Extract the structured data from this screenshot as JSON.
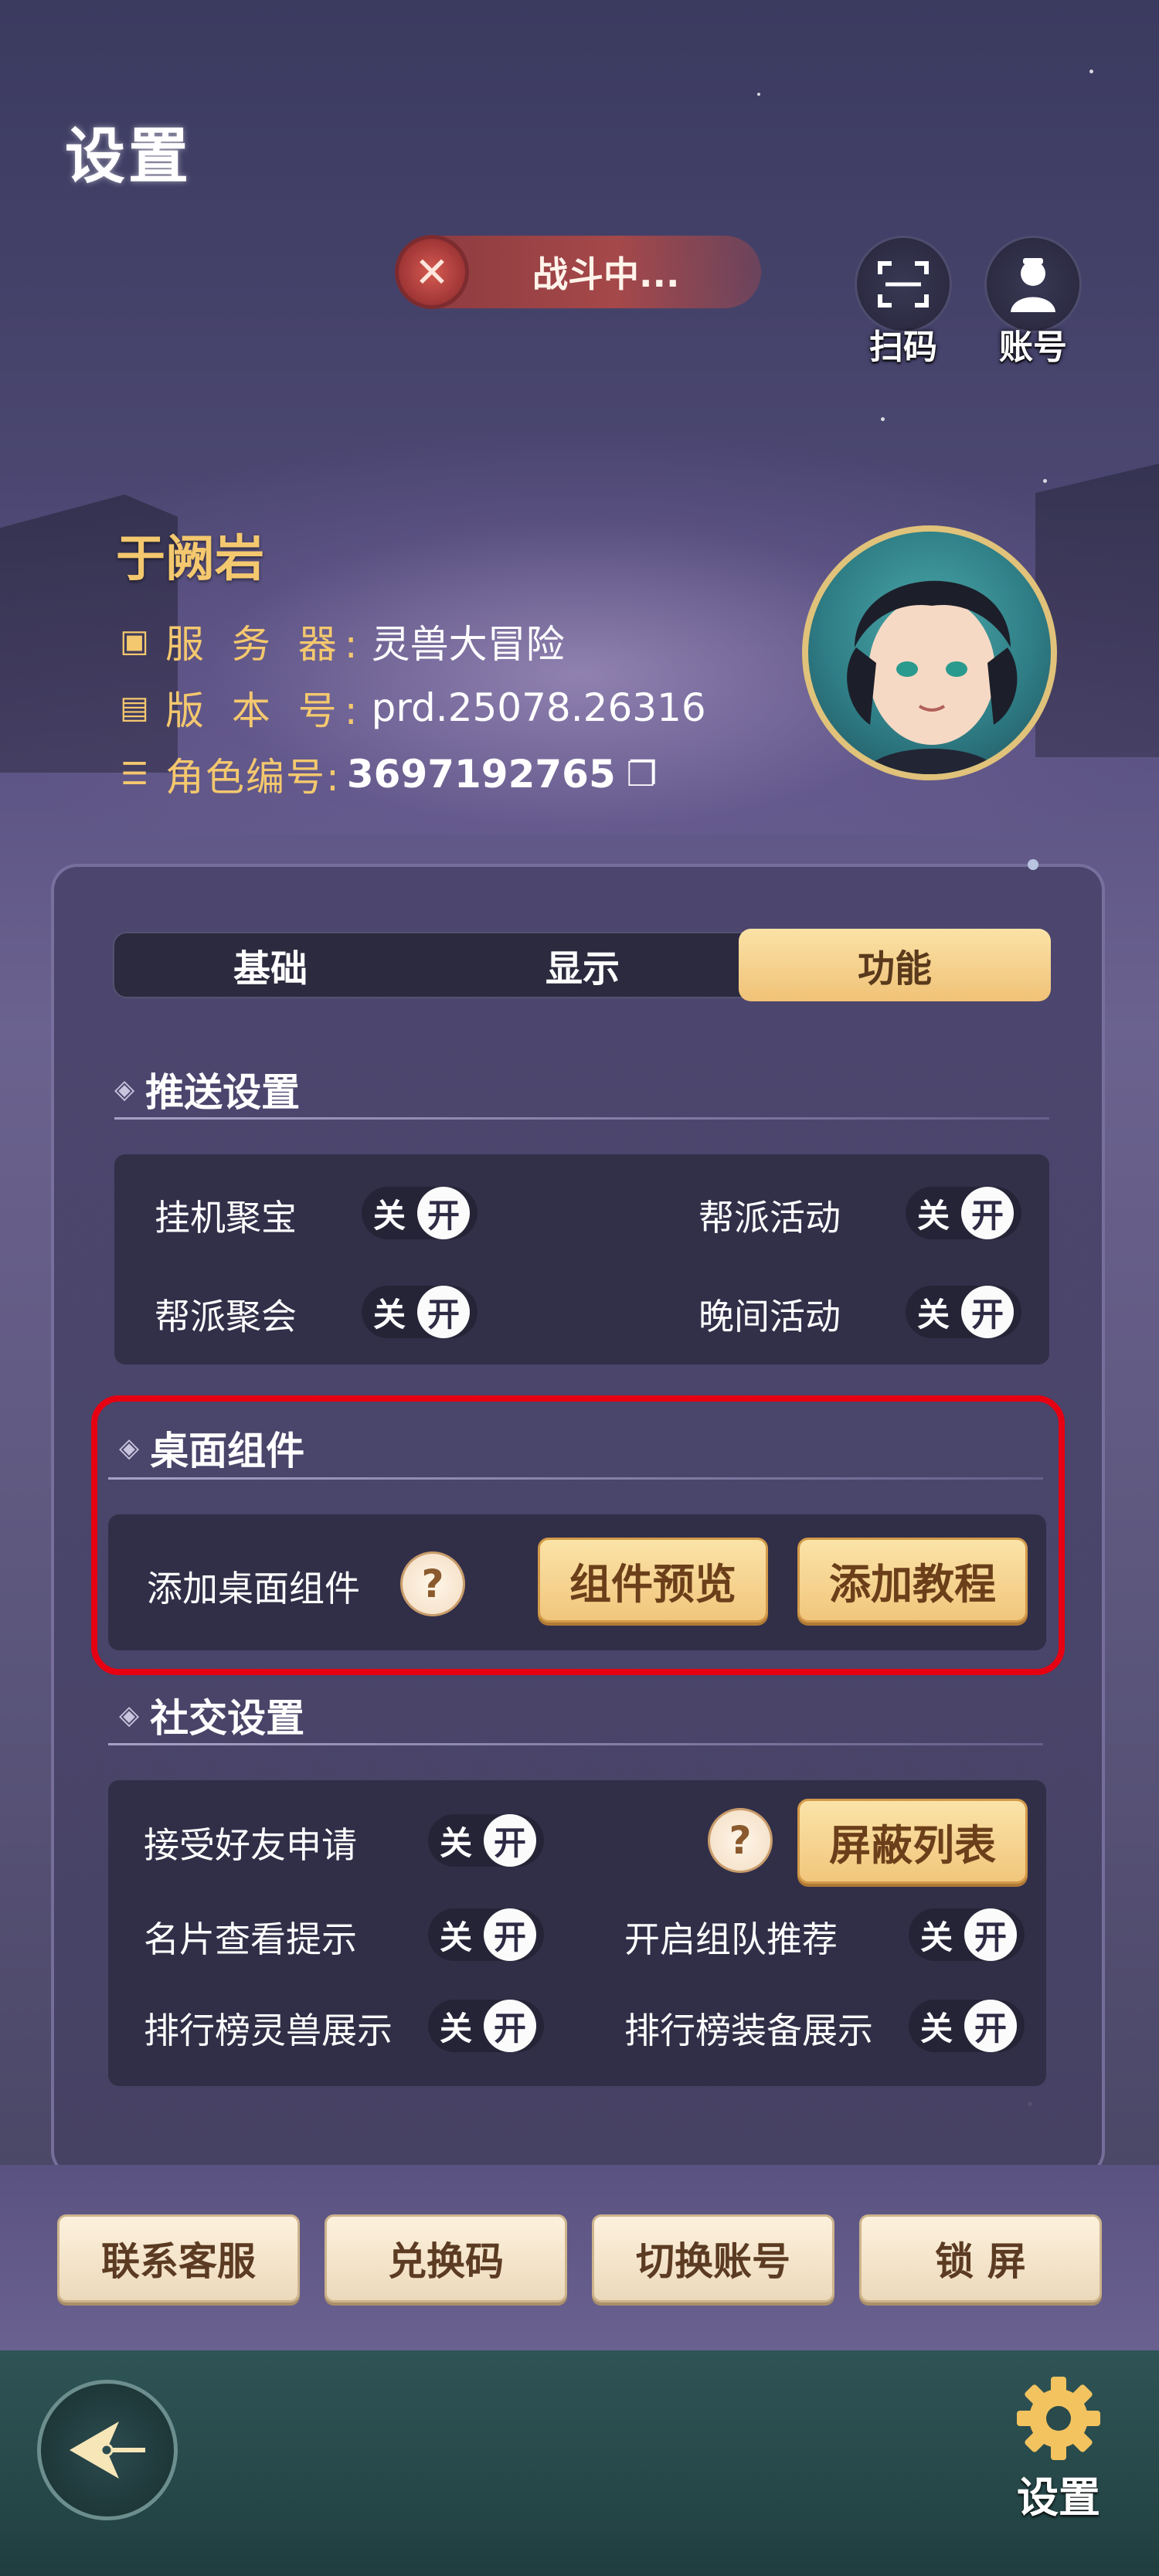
{
  "page": {
    "title": "设置"
  },
  "battle": {
    "status": "战斗中..."
  },
  "top_buttons": {
    "scan": "扫码",
    "account": "账号"
  },
  "profile": {
    "name": "于阙岩",
    "server_label": "服 务 器:",
    "server_value": "灵兽大冒险",
    "version_label": "版 本 号:",
    "version_value": "prd.25078.26316",
    "role_label": "角色编号:",
    "role_value": "3697192765"
  },
  "tabs": [
    {
      "label": "基础",
      "active": false
    },
    {
      "label": "显示",
      "active": false
    },
    {
      "label": "功能",
      "active": true
    }
  ],
  "push_settings": {
    "title": "推送设置",
    "items": [
      {
        "label": "挂机聚宝",
        "off": "关",
        "on": "开"
      },
      {
        "label": "帮派活动",
        "off": "关",
        "on": "开"
      },
      {
        "label": "帮派聚会",
        "off": "关",
        "on": "开"
      },
      {
        "label": "晚间活动",
        "off": "关",
        "on": "开"
      }
    ]
  },
  "desktop_widget": {
    "title": "桌面组件",
    "add_label": "添加桌面组件",
    "help": "?",
    "preview_button": "组件预览",
    "tutorial_button": "添加教程"
  },
  "social_settings": {
    "title": "社交设置",
    "friend_request": "接受好友申请",
    "help": "?",
    "block_list_button": "屏蔽列表",
    "card_view": "名片查看提示",
    "team_recommend": "开启组队推荐",
    "rank_pet": "排行榜灵兽展示",
    "rank_gear": "排行榜装备展示",
    "off": "关",
    "on": "开"
  },
  "bottom_buttons": {
    "support": "联系客服",
    "redeem": "兑换码",
    "switch_account": "切换账号",
    "lock_screen": "锁 屏"
  },
  "footer": {
    "settings_label": "设置"
  },
  "colors": {
    "gold": "#f4c86e",
    "highlight": "#e60012",
    "button_gold": "#f1c67c"
  }
}
